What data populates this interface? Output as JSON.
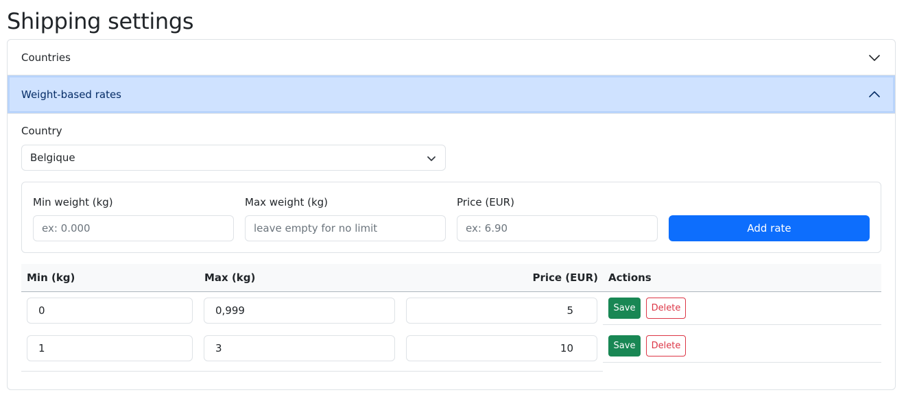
{
  "page": {
    "title": "Shipping settings"
  },
  "accordion": {
    "countries": {
      "label": "Countries",
      "icon": "chevron-down-icon"
    },
    "weight_rates": {
      "label": "Weight-based rates",
      "icon": "chevron-up-icon"
    }
  },
  "country": {
    "label": "Country",
    "selected": "Belgique"
  },
  "add_form": {
    "min_label": "Min weight (kg)",
    "min_placeholder": "ex: 0.000",
    "max_label": "Max weight (kg)",
    "max_placeholder": "leave empty for no limit",
    "price_label": "Price (EUR)",
    "price_placeholder": "ex: 6.90",
    "add_button": "Add rate"
  },
  "table": {
    "headers": {
      "min": "Min (kg)",
      "max": "Max (kg)",
      "price": "Price (EUR)",
      "actions": "Actions"
    },
    "rows": [
      {
        "min": "0",
        "max": "0,999",
        "price": "5",
        "save": "Save",
        "delete": "Delete"
      },
      {
        "min": "1",
        "max": "3",
        "price": "10",
        "save": "Save",
        "delete": "Delete"
      }
    ]
  },
  "colors": {
    "accent": "#0d6efd",
    "success": "#198754",
    "danger": "#dc3545",
    "active_header_bg": "#cfe2ff"
  }
}
